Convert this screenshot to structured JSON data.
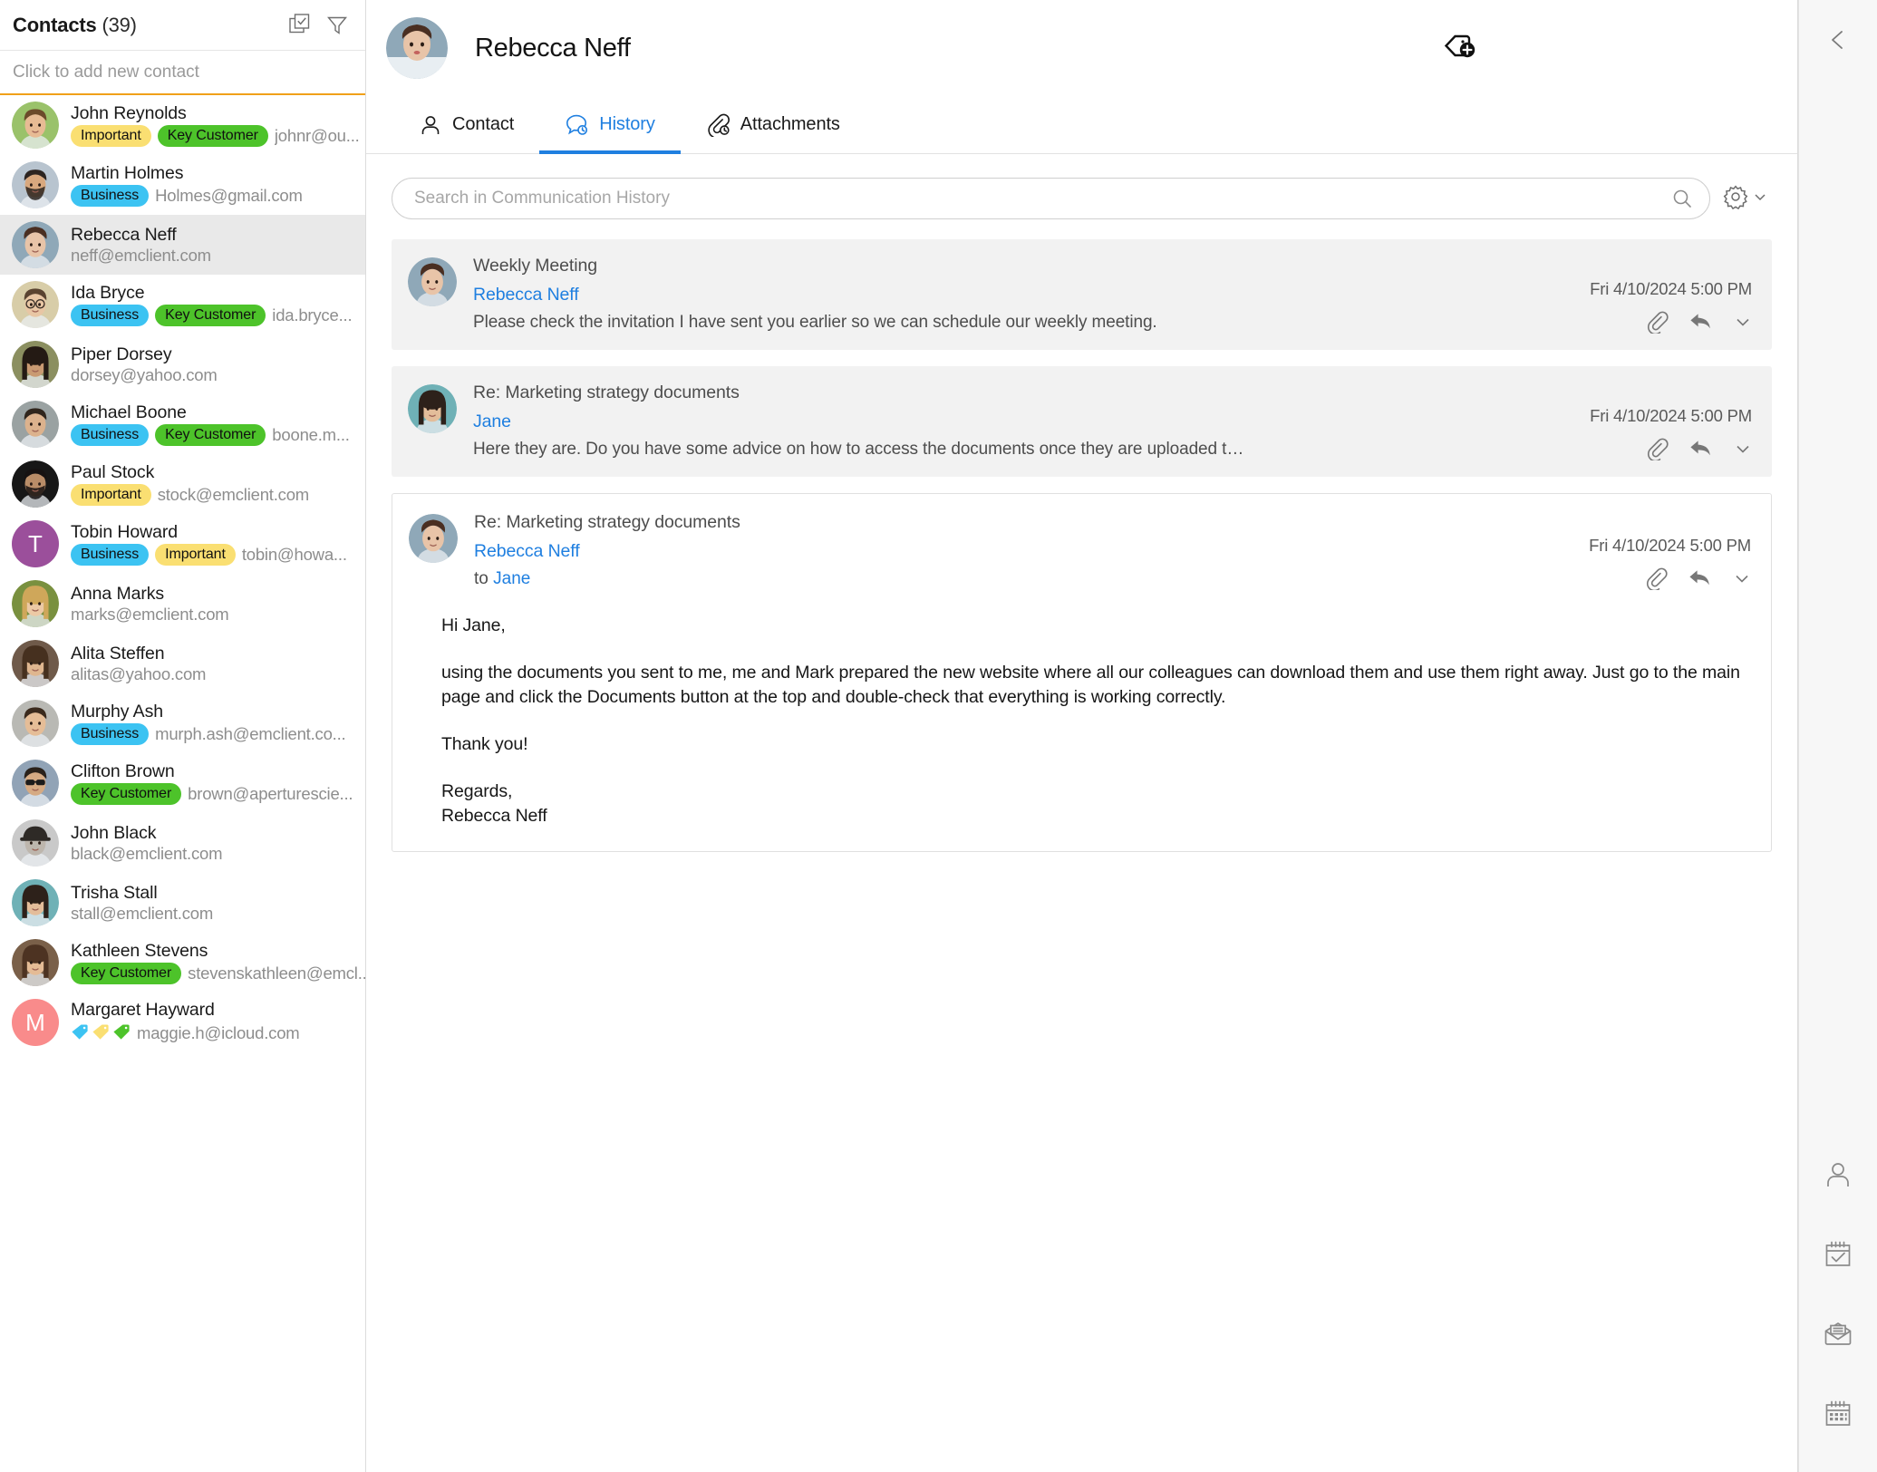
{
  "contacts_panel": {
    "title": "Contacts",
    "count_label": "(39)",
    "select_icon": "checkbox-multi-select-icon",
    "filter_icon": "filter-funnel-icon",
    "add_contact_placeholder": "Click to add new contact",
    "items": [
      {
        "name": "John Reynolds",
        "tags": [
          "Important",
          "Key Customer"
        ],
        "email": "johnr@ou...",
        "avatar_type": "photo",
        "avatar_bg": "#9ac26a",
        "initial": ""
      },
      {
        "name": "Martin Holmes",
        "tags": [
          "Business"
        ],
        "email": "Holmes@gmail.com",
        "avatar_type": "photo",
        "avatar_bg": "#b8c4cf",
        "initial": ""
      },
      {
        "name": "Rebecca Neff",
        "tags": [],
        "email": "neff@emclient.com",
        "avatar_type": "photo",
        "avatar_bg": "#8fa8b8",
        "initial": "",
        "selected": true
      },
      {
        "name": "Ida Bryce",
        "tags": [
          "Business",
          "Key Customer"
        ],
        "email": "ida.bryce...",
        "avatar_type": "photo",
        "avatar_bg": "#d8cda8",
        "initial": ""
      },
      {
        "name": "Piper Dorsey",
        "tags": [],
        "email": "dorsey@yahoo.com",
        "avatar_type": "photo",
        "avatar_bg": "#8b8f60",
        "initial": ""
      },
      {
        "name": "Michael Boone",
        "tags": [
          "Business",
          "Key Customer"
        ],
        "email": "boone.m...",
        "avatar_type": "photo",
        "avatar_bg": "#9aa2a2",
        "initial": ""
      },
      {
        "name": "Paul Stock",
        "tags": [
          "Important"
        ],
        "email": "stock@emclient.com",
        "avatar_type": "photo",
        "avatar_bg": "#171717",
        "initial": ""
      },
      {
        "name": "Tobin Howard",
        "tags": [
          "Business",
          "Important"
        ],
        "email": "tobin@howa...",
        "avatar_type": "initial",
        "avatar_bg": "#9b4f9b",
        "initial": "T"
      },
      {
        "name": "Anna Marks",
        "tags": [],
        "email": "marks@emclient.com",
        "avatar_type": "photo",
        "avatar_bg": "#79903f",
        "initial": ""
      },
      {
        "name": "Alita Steffen",
        "tags": [],
        "email": "alitas@yahoo.com",
        "avatar_type": "photo",
        "avatar_bg": "#6f5a4a",
        "initial": ""
      },
      {
        "name": "Murphy Ash",
        "tags": [
          "Business"
        ],
        "email": "murph.ash@emclient.co...",
        "avatar_type": "photo",
        "avatar_bg": "#b9b9b4",
        "initial": ""
      },
      {
        "name": "Clifton Brown",
        "tags": [
          "Key Customer"
        ],
        "email": "brown@aperturescie...",
        "avatar_type": "photo",
        "avatar_bg": "#91a3b6",
        "initial": ""
      },
      {
        "name": "John Black",
        "tags": [],
        "email": "black@emclient.com",
        "avatar_type": "photo",
        "avatar_bg": "#c9c9c9",
        "initial": ""
      },
      {
        "name": "Trisha Stall",
        "tags": [],
        "email": "stall@emclient.com",
        "avatar_type": "photo",
        "avatar_bg": "#6fb1b6",
        "initial": ""
      },
      {
        "name": "Kathleen Stevens",
        "tags": [
          "Key Customer"
        ],
        "email": "stevenskathleen@emcl...",
        "avatar_type": "photo",
        "avatar_bg": "#7a6049",
        "initial": ""
      },
      {
        "name": "Margaret Hayward",
        "tags": [],
        "tag_dots": [
          "#3cc3f2",
          "#fadf72",
          "#4dc32a"
        ],
        "email": "maggie.h@icloud.com",
        "avatar_type": "initial",
        "avatar_bg": "#f98b8b",
        "initial": "M"
      }
    ],
    "tag_colors": {
      "Business": "#3cc3f2",
      "Important": "#fadf72",
      "Key Customer": "#4dc32a"
    }
  },
  "detail": {
    "contact_name": "Rebecca Neff",
    "add_tag_icon": "tag-add-icon",
    "tabs": [
      {
        "label": "Contact",
        "icon": "person-icon",
        "active": false
      },
      {
        "label": "History",
        "icon": "chat-history-icon",
        "active": true
      },
      {
        "label": "Attachments",
        "icon": "paperclip-clock-icon",
        "active": false
      }
    ],
    "accent_color": "#1f7fe0",
    "search": {
      "placeholder": "Search in Communication History",
      "value": "",
      "search_icon": "search-icon",
      "settings_icon": "gear-icon",
      "chevron_icon": "chevron-down-icon"
    },
    "messages": [
      {
        "subject": "Weekly Meeting",
        "from": "Rebecca Neff",
        "to": "",
        "preview": "Please check the invitation I have sent you earlier so we can schedule our weekly meeting.",
        "date": "Fri 4/10/2024 5:00 PM",
        "expanded": false,
        "actions": [
          "paperclip-icon",
          "reply-icon",
          "chevron-down-icon"
        ]
      },
      {
        "subject": "Re: Marketing strategy documents",
        "from": "Jane",
        "to": "",
        "preview": "Here they are. Do you have some advice on how to access the documents once they are uploaded to the new...",
        "date": "Fri 4/10/2024 5:00 PM",
        "expanded": false,
        "actions": [
          "paperclip-icon",
          "reply-icon",
          "chevron-down-icon"
        ]
      },
      {
        "subject": "Re: Marketing strategy documents",
        "from": "Rebecca Neff",
        "to_prefix": "to ",
        "to": "Jane",
        "date": "Fri 4/10/2024 5:00 PM",
        "expanded": true,
        "actions": [
          "paperclip-icon",
          "reply-icon",
          "chevron-down-icon"
        ],
        "body": {
          "greeting": "Hi Jane,",
          "paragraph": "using the documents you sent to me, me and Mark prepared the new website where all our colleagues can download them and use them right away. Just go to the main page and click the Documents button at the top and double-check that everything is working correctly.",
          "thanks": "Thank you!",
          "closing": "Regards,",
          "signature": "Rebecca Neff"
        }
      }
    ]
  },
  "right_rail": {
    "collapse_icon": "chevron-left-icon",
    "buttons": [
      {
        "icon": "person-icon",
        "name": "contacts"
      },
      {
        "icon": "tasks-calendar-check-icon",
        "name": "tasks"
      },
      {
        "icon": "envelope-icon",
        "name": "mail"
      },
      {
        "icon": "calendar-icon",
        "name": "calendar"
      }
    ]
  }
}
